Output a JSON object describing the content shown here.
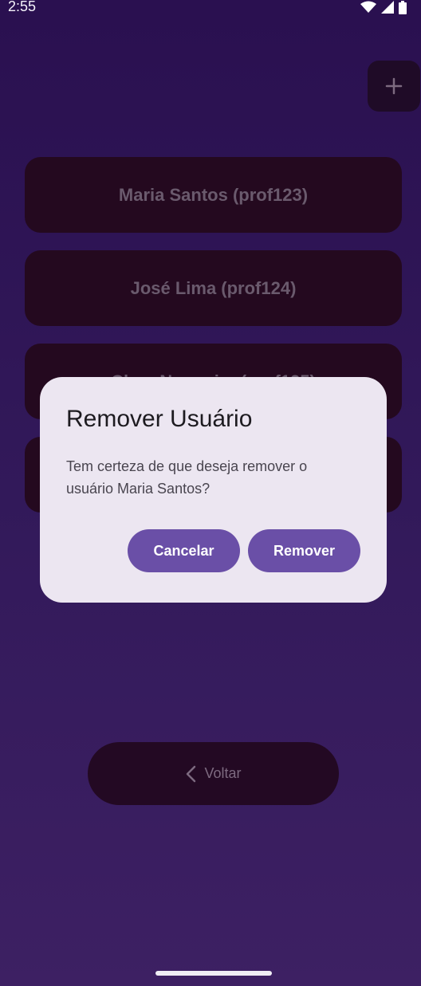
{
  "status_bar": {
    "time": "2:55"
  },
  "toolbar": {
    "add_icon": "plus-icon"
  },
  "users": [
    {
      "label": "Maria Santos (prof123)"
    },
    {
      "label": "José Lima (prof124)"
    },
    {
      "label": "Clara Nogueira (prof125)"
    },
    {
      "label": ""
    }
  ],
  "back_button": {
    "label": "Voltar",
    "icon": "chevron-left-icon"
  },
  "dialog": {
    "title": "Remover Usuário",
    "message": "Tem certeza de que deseja remover o usuário Maria Santos?",
    "cancel_label": "Cancelar",
    "confirm_label": "Remover"
  },
  "colors": {
    "background_top": "#2a1050",
    "background_bottom": "#3d2063",
    "card": "#24091f",
    "dialog_surface": "#ece6f1",
    "primary": "#6a4fa7"
  }
}
